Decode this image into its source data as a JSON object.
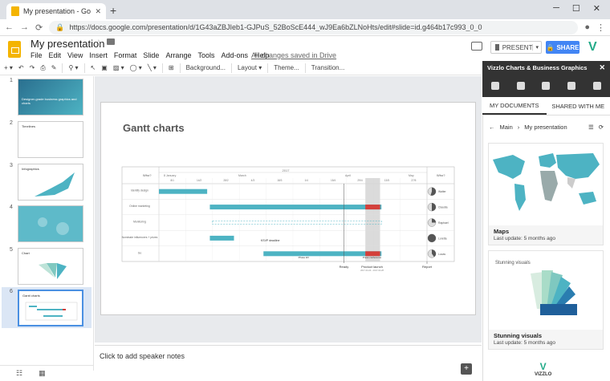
{
  "browser": {
    "tab_title": "My presentation - Google Slides",
    "url": "https://docs.google.com/presentation/d/1G43aZBJIeb1-GJPuS_52BoScE444_wJ9Ea6bZLNoHts/edit#slide=id.g464b17c993_0_0"
  },
  "docs": {
    "title": "My presentation",
    "menus": [
      "File",
      "Edit",
      "View",
      "Insert",
      "Format",
      "Slide",
      "Arrange",
      "Tools",
      "Add-ons",
      "Help"
    ],
    "saved_status": "All changes saved in Drive",
    "present_label": "PRESENT",
    "share_label": "SHARE"
  },
  "toolbar": {
    "background_label": "Background...",
    "layout_label": "Layout ▾",
    "theme_label": "Theme...",
    "transition_label": "Transition..."
  },
  "filmstrip": {
    "slides": [
      {
        "num": "1",
        "text": "Designer-grade business graphics and charts"
      },
      {
        "num": "2",
        "text": "Timelines"
      },
      {
        "num": "3",
        "text": "Infographics"
      },
      {
        "num": "4",
        "text": ""
      },
      {
        "num": "5",
        "text": "Chart"
      },
      {
        "num": "6",
        "text": "Gantt charts"
      }
    ],
    "selected": "6"
  },
  "slide": {
    "title": "Gantt charts",
    "gantt": {
      "year": "2017",
      "who_header": "Who?",
      "months": [
        "8 January",
        "March",
        "April",
        "May"
      ],
      "weeks": [
        "8/1",
        "14/2",
        "28/2",
        "4/3",
        "18/3",
        "1/4",
        "15/4",
        "29/4",
        "13/5",
        "27/5"
      ],
      "rows": [
        {
          "label": "Identify design",
          "person": "Walter",
          "progress": 0.55
        },
        {
          "label": "Online marketing",
          "person": "Claudia",
          "progress": 0.5
        },
        {
          "label": "Monitoring",
          "person": "Raphael",
          "progress": 0.25
        },
        {
          "label": "Nominate influencers + prizes",
          "person": "Loretta",
          "progress": 1.0
        },
        {
          "label": "Go",
          "person": "Lucas",
          "progress": 0.4
        }
      ],
      "annotations": {
        "ksvp": "KSVP deadline",
        "phase": "Phase kill",
        "press": "Press conference",
        "ready": "Ready",
        "launch": "Product launch",
        "launch_dates": "2017-04-24 - 2017-04-28",
        "report": "Report"
      }
    }
  },
  "notes_placeholder": "Click to add speaker notes",
  "panel": {
    "title": "Vizzlo Charts & Business Graphics",
    "tabs": [
      "MY DOCUMENTS",
      "SHARED WITH ME"
    ],
    "breadcrumb_root": "Main",
    "breadcrumb_current": "My presentation",
    "cards": [
      {
        "title": "Maps",
        "subtitle": "Last update: 5 months ago"
      },
      {
        "title": "Stunning visuals",
        "subtitle": "Last update: 5 months ago"
      }
    ],
    "card2_caption": "Stunning visuals",
    "footer_brand": "VIZZLO"
  },
  "colors": {
    "teal": "#4db3c3",
    "red": "#d43f3a",
    "accent_blue": "#4285f4",
    "panel_dark": "#333333"
  }
}
